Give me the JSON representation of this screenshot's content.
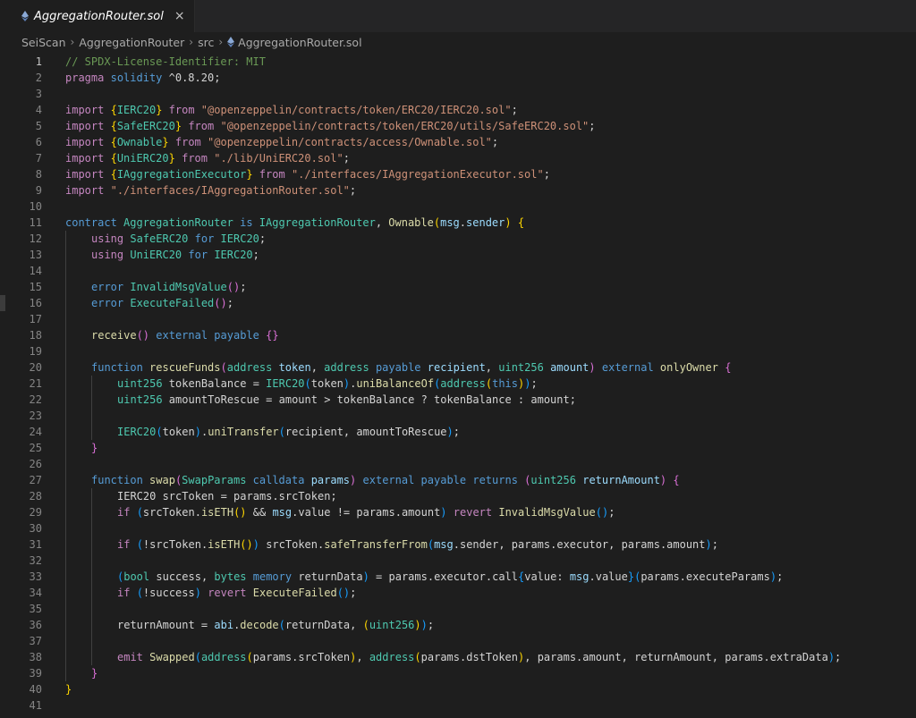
{
  "tab": {
    "filename": "AggregationRouter.sol",
    "close_glyph": "×"
  },
  "breadcrumbs": [
    "SeiScan",
    "AggregationRouter",
    "src",
    "AggregationRouter.sol"
  ],
  "active_line": 1,
  "colors": {
    "comment": "#6a9955",
    "kw": "#569cd6",
    "ctrl": "#c586c0",
    "str": "#ce9178",
    "type": "#4ec9b0",
    "fn": "#dcdcaa",
    "var": "#9cdcfe",
    "num": "#b5cea8",
    "b1": "#ffd700",
    "b2": "#da70d6",
    "b3": "#179fff",
    "p": "#d4d4d4"
  },
  "lines": [
    {
      "n": 1,
      "indent": 0,
      "tokens": [
        [
          "comment",
          "// SPDX-License-Identifier: MIT"
        ]
      ]
    },
    {
      "n": 2,
      "indent": 0,
      "tokens": [
        [
          "ctrl",
          "pragma"
        ],
        [
          "p",
          " "
        ],
        [
          "kw",
          "solidity"
        ],
        [
          "p",
          " ^0.8.20;"
        ]
      ]
    },
    {
      "n": 3,
      "indent": 0,
      "tokens": []
    },
    {
      "n": 4,
      "indent": 0,
      "tokens": [
        [
          "ctrl",
          "import"
        ],
        [
          "p",
          " "
        ],
        [
          "b1",
          "{"
        ],
        [
          "type",
          "IERC20"
        ],
        [
          "b1",
          "}"
        ],
        [
          "p",
          " "
        ],
        [
          "ctrl",
          "from"
        ],
        [
          "p",
          " "
        ],
        [
          "str",
          "\"@openzeppelin/contracts/token/ERC20/IERC20.sol\""
        ],
        [
          "p",
          ";"
        ]
      ]
    },
    {
      "n": 5,
      "indent": 0,
      "tokens": [
        [
          "ctrl",
          "import"
        ],
        [
          "p",
          " "
        ],
        [
          "b1",
          "{"
        ],
        [
          "type",
          "SafeERC20"
        ],
        [
          "b1",
          "}"
        ],
        [
          "p",
          " "
        ],
        [
          "ctrl",
          "from"
        ],
        [
          "p",
          " "
        ],
        [
          "str",
          "\"@openzeppelin/contracts/token/ERC20/utils/SafeERC20.sol\""
        ],
        [
          "p",
          ";"
        ]
      ]
    },
    {
      "n": 6,
      "indent": 0,
      "tokens": [
        [
          "ctrl",
          "import"
        ],
        [
          "p",
          " "
        ],
        [
          "b1",
          "{"
        ],
        [
          "type",
          "Ownable"
        ],
        [
          "b1",
          "}"
        ],
        [
          "p",
          " "
        ],
        [
          "ctrl",
          "from"
        ],
        [
          "p",
          " "
        ],
        [
          "str",
          "\"@openzeppelin/contracts/access/Ownable.sol\""
        ],
        [
          "p",
          ";"
        ]
      ]
    },
    {
      "n": 7,
      "indent": 0,
      "tokens": [
        [
          "ctrl",
          "import"
        ],
        [
          "p",
          " "
        ],
        [
          "b1",
          "{"
        ],
        [
          "type",
          "UniERC20"
        ],
        [
          "b1",
          "}"
        ],
        [
          "p",
          " "
        ],
        [
          "ctrl",
          "from"
        ],
        [
          "p",
          " "
        ],
        [
          "str",
          "\"./lib/UniERC20.sol\""
        ],
        [
          "p",
          ";"
        ]
      ]
    },
    {
      "n": 8,
      "indent": 0,
      "tokens": [
        [
          "ctrl",
          "import"
        ],
        [
          "p",
          " "
        ],
        [
          "b1",
          "{"
        ],
        [
          "type",
          "IAggregationExecutor"
        ],
        [
          "b1",
          "}"
        ],
        [
          "p",
          " "
        ],
        [
          "ctrl",
          "from"
        ],
        [
          "p",
          " "
        ],
        [
          "str",
          "\"./interfaces/IAggregationExecutor.sol\""
        ],
        [
          "p",
          ";"
        ]
      ]
    },
    {
      "n": 9,
      "indent": 0,
      "tokens": [
        [
          "ctrl",
          "import"
        ],
        [
          "p",
          " "
        ],
        [
          "str",
          "\"./interfaces/IAggregationRouter.sol\""
        ],
        [
          "p",
          ";"
        ]
      ]
    },
    {
      "n": 10,
      "indent": 0,
      "tokens": []
    },
    {
      "n": 11,
      "indent": 0,
      "tokens": [
        [
          "kw",
          "contract"
        ],
        [
          "p",
          " "
        ],
        [
          "type",
          "AggregationRouter"
        ],
        [
          "p",
          " "
        ],
        [
          "kw",
          "is"
        ],
        [
          "p",
          " "
        ],
        [
          "type",
          "IAggregationRouter"
        ],
        [
          "p",
          ", "
        ],
        [
          "fn",
          "Ownable"
        ],
        [
          "b1",
          "("
        ],
        [
          "var",
          "msg"
        ],
        [
          "p",
          "."
        ],
        [
          "var",
          "sender"
        ],
        [
          "b1",
          ")"
        ],
        [
          "p",
          " "
        ],
        [
          "b1",
          "{"
        ]
      ]
    },
    {
      "n": 12,
      "indent": 1,
      "tokens": [
        [
          "ctrl",
          "using"
        ],
        [
          "p",
          " "
        ],
        [
          "type",
          "SafeERC20"
        ],
        [
          "p",
          " "
        ],
        [
          "kw",
          "for"
        ],
        [
          "p",
          " "
        ],
        [
          "type",
          "IERC20"
        ],
        [
          "p",
          ";"
        ]
      ]
    },
    {
      "n": 13,
      "indent": 1,
      "tokens": [
        [
          "ctrl",
          "using"
        ],
        [
          "p",
          " "
        ],
        [
          "type",
          "UniERC20"
        ],
        [
          "p",
          " "
        ],
        [
          "kw",
          "for"
        ],
        [
          "p",
          " "
        ],
        [
          "type",
          "IERC20"
        ],
        [
          "p",
          ";"
        ]
      ]
    },
    {
      "n": 14,
      "indent": 1,
      "tokens": []
    },
    {
      "n": 15,
      "indent": 1,
      "tokens": [
        [
          "kw",
          "error"
        ],
        [
          "p",
          " "
        ],
        [
          "type",
          "InvalidMsgValue"
        ],
        [
          "b2",
          "()"
        ],
        [
          "p",
          ";"
        ]
      ]
    },
    {
      "n": 16,
      "indent": 1,
      "tokens": [
        [
          "kw",
          "error"
        ],
        [
          "p",
          " "
        ],
        [
          "type",
          "ExecuteFailed"
        ],
        [
          "b2",
          "()"
        ],
        [
          "p",
          ";"
        ]
      ]
    },
    {
      "n": 17,
      "indent": 1,
      "tokens": []
    },
    {
      "n": 18,
      "indent": 1,
      "tokens": [
        [
          "fn",
          "receive"
        ],
        [
          "b2",
          "()"
        ],
        [
          "p",
          " "
        ],
        [
          "kw",
          "external"
        ],
        [
          "p",
          " "
        ],
        [
          "kw",
          "payable"
        ],
        [
          "p",
          " "
        ],
        [
          "b2",
          "{}"
        ]
      ]
    },
    {
      "n": 19,
      "indent": 1,
      "tokens": []
    },
    {
      "n": 20,
      "indent": 1,
      "tokens": [
        [
          "kw",
          "function"
        ],
        [
          "p",
          " "
        ],
        [
          "fn",
          "rescueFunds"
        ],
        [
          "b2",
          "("
        ],
        [
          "type",
          "address"
        ],
        [
          "p",
          " "
        ],
        [
          "var",
          "token"
        ],
        [
          "p",
          ", "
        ],
        [
          "type",
          "address"
        ],
        [
          "p",
          " "
        ],
        [
          "kw",
          "payable"
        ],
        [
          "p",
          " "
        ],
        [
          "var",
          "recipient"
        ],
        [
          "p",
          ", "
        ],
        [
          "type",
          "uint256"
        ],
        [
          "p",
          " "
        ],
        [
          "var",
          "amount"
        ],
        [
          "b2",
          ")"
        ],
        [
          "p",
          " "
        ],
        [
          "kw",
          "external"
        ],
        [
          "p",
          " "
        ],
        [
          "fn",
          "onlyOwner"
        ],
        [
          "p",
          " "
        ],
        [
          "b2",
          "{"
        ]
      ]
    },
    {
      "n": 21,
      "indent": 2,
      "tokens": [
        [
          "type",
          "uint256"
        ],
        [
          "p",
          " tokenBalance = "
        ],
        [
          "type",
          "IERC20"
        ],
        [
          "b3",
          "("
        ],
        [
          "p",
          "token"
        ],
        [
          "b3",
          ")"
        ],
        [
          "p",
          "."
        ],
        [
          "fn",
          "uniBalanceOf"
        ],
        [
          "b3",
          "("
        ],
        [
          "type",
          "address"
        ],
        [
          "b1",
          "("
        ],
        [
          "kw",
          "this"
        ],
        [
          "b1",
          ")"
        ],
        [
          "b3",
          ")"
        ],
        [
          "p",
          ";"
        ]
      ]
    },
    {
      "n": 22,
      "indent": 2,
      "tokens": [
        [
          "type",
          "uint256"
        ],
        [
          "p",
          " amountToRescue = amount > tokenBalance ? tokenBalance : amount;"
        ]
      ]
    },
    {
      "n": 23,
      "indent": 2,
      "tokens": []
    },
    {
      "n": 24,
      "indent": 2,
      "tokens": [
        [
          "type",
          "IERC20"
        ],
        [
          "b3",
          "("
        ],
        [
          "p",
          "token"
        ],
        [
          "b3",
          ")"
        ],
        [
          "p",
          "."
        ],
        [
          "fn",
          "uniTransfer"
        ],
        [
          "b3",
          "("
        ],
        [
          "p",
          "recipient, amountToRescue"
        ],
        [
          "b3",
          ")"
        ],
        [
          "p",
          ";"
        ]
      ]
    },
    {
      "n": 25,
      "indent": 1,
      "tokens": [
        [
          "b2",
          "}"
        ]
      ]
    },
    {
      "n": 26,
      "indent": 1,
      "tokens": []
    },
    {
      "n": 27,
      "indent": 1,
      "tokens": [
        [
          "kw",
          "function"
        ],
        [
          "p",
          " "
        ],
        [
          "fn",
          "swap"
        ],
        [
          "b2",
          "("
        ],
        [
          "type",
          "SwapParams"
        ],
        [
          "p",
          " "
        ],
        [
          "kw",
          "calldata"
        ],
        [
          "p",
          " "
        ],
        [
          "var",
          "params"
        ],
        [
          "b2",
          ")"
        ],
        [
          "p",
          " "
        ],
        [
          "kw",
          "external"
        ],
        [
          "p",
          " "
        ],
        [
          "kw",
          "payable"
        ],
        [
          "p",
          " "
        ],
        [
          "kw",
          "returns"
        ],
        [
          "p",
          " "
        ],
        [
          "b2",
          "("
        ],
        [
          "type",
          "uint256"
        ],
        [
          "p",
          " "
        ],
        [
          "var",
          "returnAmount"
        ],
        [
          "b2",
          ")"
        ],
        [
          "p",
          " "
        ],
        [
          "b2",
          "{"
        ]
      ]
    },
    {
      "n": 28,
      "indent": 2,
      "tokens": [
        [
          "p",
          "IERC20 srcToken = params.srcToken;"
        ]
      ]
    },
    {
      "n": 29,
      "indent": 2,
      "tokens": [
        [
          "ctrl",
          "if"
        ],
        [
          "p",
          " "
        ],
        [
          "b3",
          "("
        ],
        [
          "p",
          "srcToken."
        ],
        [
          "fn",
          "isETH"
        ],
        [
          "b1",
          "()"
        ],
        [
          "p",
          " && "
        ],
        [
          "var",
          "msg"
        ],
        [
          "p",
          ".value != params.amount"
        ],
        [
          "b3",
          ")"
        ],
        [
          "p",
          " "
        ],
        [
          "ctrl",
          "revert"
        ],
        [
          "p",
          " "
        ],
        [
          "fn",
          "InvalidMsgValue"
        ],
        [
          "b3",
          "()"
        ],
        [
          "p",
          ";"
        ]
      ]
    },
    {
      "n": 30,
      "indent": 2,
      "tokens": []
    },
    {
      "n": 31,
      "indent": 2,
      "tokens": [
        [
          "ctrl",
          "if"
        ],
        [
          "p",
          " "
        ],
        [
          "b3",
          "("
        ],
        [
          "p",
          "!srcToken."
        ],
        [
          "fn",
          "isETH"
        ],
        [
          "b1",
          "()"
        ],
        [
          "b3",
          ")"
        ],
        [
          "p",
          " srcToken."
        ],
        [
          "fn",
          "safeTransferFrom"
        ],
        [
          "b3",
          "("
        ],
        [
          "var",
          "msg"
        ],
        [
          "p",
          ".sender, params.executor, params.amount"
        ],
        [
          "b3",
          ")"
        ],
        [
          "p",
          ";"
        ]
      ]
    },
    {
      "n": 32,
      "indent": 2,
      "tokens": []
    },
    {
      "n": 33,
      "indent": 2,
      "tokens": [
        [
          "b3",
          "("
        ],
        [
          "type",
          "bool"
        ],
        [
          "p",
          " success, "
        ],
        [
          "type",
          "bytes"
        ],
        [
          "p",
          " "
        ],
        [
          "kw",
          "memory"
        ],
        [
          "p",
          " returnData"
        ],
        [
          "b3",
          ")"
        ],
        [
          "p",
          " = params.executor.call"
        ],
        [
          "b3",
          "{"
        ],
        [
          "p",
          "value: "
        ],
        [
          "var",
          "msg"
        ],
        [
          "p",
          ".value"
        ],
        [
          "b3",
          "}"
        ],
        [
          "b3",
          "("
        ],
        [
          "p",
          "params.executeParams"
        ],
        [
          "b3",
          ")"
        ],
        [
          "p",
          ";"
        ]
      ]
    },
    {
      "n": 34,
      "indent": 2,
      "tokens": [
        [
          "ctrl",
          "if"
        ],
        [
          "p",
          " "
        ],
        [
          "b3",
          "("
        ],
        [
          "p",
          "!success"
        ],
        [
          "b3",
          ")"
        ],
        [
          "p",
          " "
        ],
        [
          "ctrl",
          "revert"
        ],
        [
          "p",
          " "
        ],
        [
          "fn",
          "ExecuteFailed"
        ],
        [
          "b3",
          "()"
        ],
        [
          "p",
          ";"
        ]
      ]
    },
    {
      "n": 35,
      "indent": 2,
      "tokens": []
    },
    {
      "n": 36,
      "indent": 2,
      "tokens": [
        [
          "p",
          "returnAmount = "
        ],
        [
          "var",
          "abi"
        ],
        [
          "p",
          "."
        ],
        [
          "fn",
          "decode"
        ],
        [
          "b3",
          "("
        ],
        [
          "p",
          "returnData, "
        ],
        [
          "b1",
          "("
        ],
        [
          "type",
          "uint256"
        ],
        [
          "b1",
          ")"
        ],
        [
          "b3",
          ")"
        ],
        [
          "p",
          ";"
        ]
      ]
    },
    {
      "n": 37,
      "indent": 2,
      "tokens": []
    },
    {
      "n": 38,
      "indent": 2,
      "tokens": [
        [
          "ctrl",
          "emit"
        ],
        [
          "p",
          " "
        ],
        [
          "fn",
          "Swapped"
        ],
        [
          "b3",
          "("
        ],
        [
          "type",
          "address"
        ],
        [
          "b1",
          "("
        ],
        [
          "p",
          "params.srcToken"
        ],
        [
          "b1",
          ")"
        ],
        [
          "p",
          ", "
        ],
        [
          "type",
          "address"
        ],
        [
          "b1",
          "("
        ],
        [
          "p",
          "params.dstToken"
        ],
        [
          "b1",
          ")"
        ],
        [
          "p",
          ", params.amount, returnAmount, params.extraData"
        ],
        [
          "b3",
          ")"
        ],
        [
          "p",
          ";"
        ]
      ]
    },
    {
      "n": 39,
      "indent": 1,
      "tokens": [
        [
          "b2",
          "}"
        ]
      ]
    },
    {
      "n": 40,
      "indent": 0,
      "tokens": [
        [
          "b1",
          "}"
        ]
      ]
    },
    {
      "n": 41,
      "indent": 0,
      "tokens": []
    }
  ]
}
